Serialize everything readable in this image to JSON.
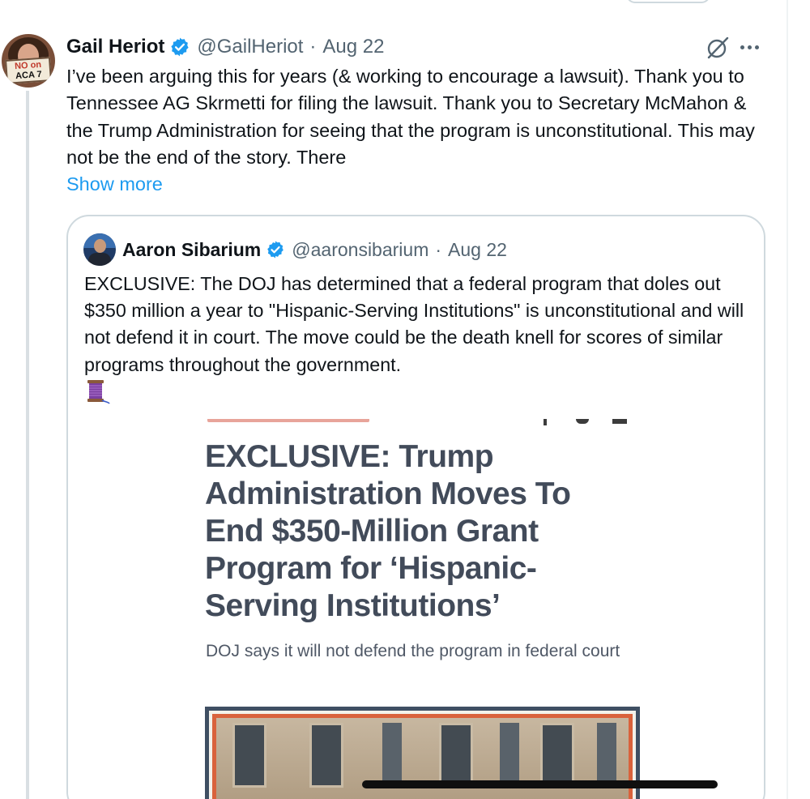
{
  "tweet": {
    "author_name": "Gail Heriot",
    "author_handle": "@GailHeriot",
    "separator": "·",
    "date": "Aug 22",
    "avatar_sign": [
      "NO on",
      "ACA 7"
    ],
    "text": "I’ve been arguing this for years (& working to encourage a lawsuit). Thank you to Tennessee AG Skrmetti for filing the lawsuit. Thank you to Secretary McMahon & the Trump Administration for seeing that the program is unconstitutional.  This may not be the end of the story. There",
    "show_more": "Show more",
    "icons": [
      "verified-badge-icon",
      "grok-icon",
      "more-options-icon"
    ]
  },
  "quoted_tweet": {
    "author_name": "Aaron Sibarium",
    "author_handle": "@aaronsibarium",
    "separator": "·",
    "date": "Aug 22",
    "text": "EXCLUSIVE: The DOJ has determined that a federal program that doles out $350 million a year to \"Hispanic-Serving Institutions\" is unconstitutional and will not defend it in court. The move could be the death knell for scores of similar programs throughout the government.",
    "emoji": "🧵",
    "media": {
      "headline": "EXCLUSIVE: Trump Administration Moves To End $350-Million Grant Program for ‘Hispanic-Serving Institutions’",
      "dek": "DOJ says it will not defend the program in federal court"
    }
  },
  "colors": {
    "text": "#0f1419",
    "secondary": "#536471",
    "link": "#1d9bf0",
    "verified": "#1d9bf0",
    "border": "#cfd9de",
    "headline": "#424b5a"
  }
}
